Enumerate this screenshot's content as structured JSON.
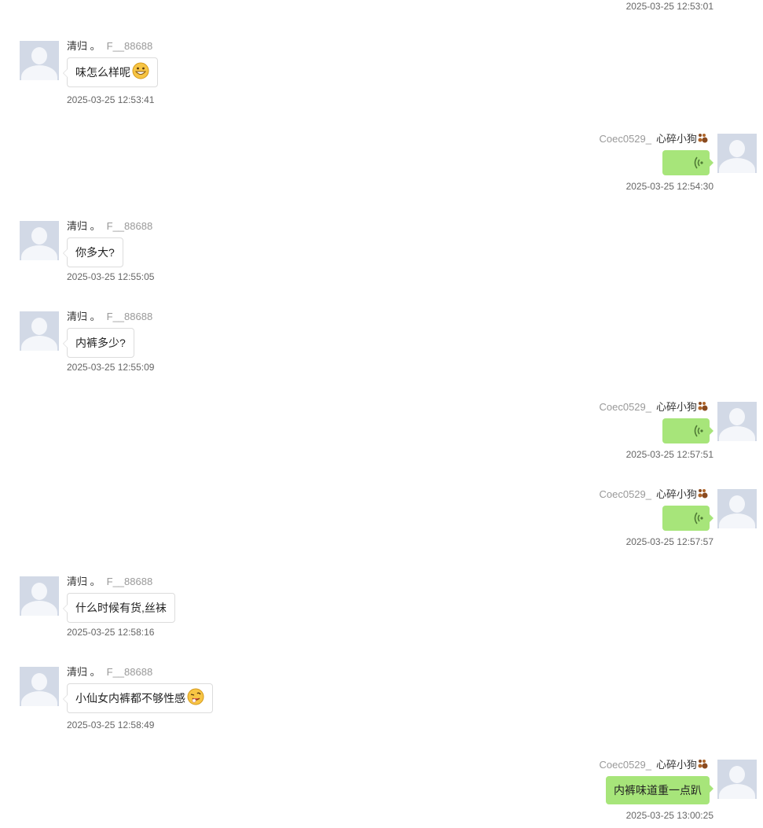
{
  "top_time": "2025-03-25 12:53:01",
  "messages": [
    {
      "side": "left",
      "nick": "清归 。",
      "uid": "F__88688",
      "text": "味怎么样呢",
      "emoji": "grin",
      "time": "2025-03-25 12:53:41"
    },
    {
      "side": "right",
      "nick": "心碎小狗",
      "uid": "Coec0529_",
      "voice": true,
      "time": "2025-03-25 12:54:30"
    },
    {
      "side": "left",
      "nick": "清归 。",
      "uid": "F__88688",
      "text": "你多大?",
      "time": "2025-03-25 12:55:05"
    },
    {
      "side": "left",
      "nick": "清归 。",
      "uid": "F__88688",
      "text": "内裤多少?",
      "time": "2025-03-25 12:55:09"
    },
    {
      "side": "right",
      "nick": "心碎小狗",
      "uid": "Coec0529_",
      "voice": true,
      "time": "2025-03-25 12:57:51"
    },
    {
      "side": "right",
      "nick": "心碎小狗",
      "uid": "Coec0529_",
      "voice": true,
      "time": "2025-03-25 12:57:57"
    },
    {
      "side": "left",
      "nick": "清归 。",
      "uid": "F__88688",
      "text": "什么时候有货,丝袜",
      "time": "2025-03-25 12:58:16"
    },
    {
      "side": "left",
      "nick": "清归 。",
      "uid": "F__88688",
      "text": "小仙女内裤都不够性感",
      "emoji": "tease",
      "time": "2025-03-25 12:58:49"
    },
    {
      "side": "right",
      "nick": "心碎小狗",
      "uid": "Coec0529_",
      "text": "内裤味道重一点趴",
      "time": "2025-03-25 13:00:25"
    }
  ],
  "icons": {
    "avatar": "default-avatar-icon",
    "voice": "voice-wave-icon",
    "paw": "paw-icon"
  },
  "colors": {
    "sent_bubble": "#a7e57a",
    "received_bubble": "#ffffff",
    "avatar_bg": "#d2d9e6"
  }
}
